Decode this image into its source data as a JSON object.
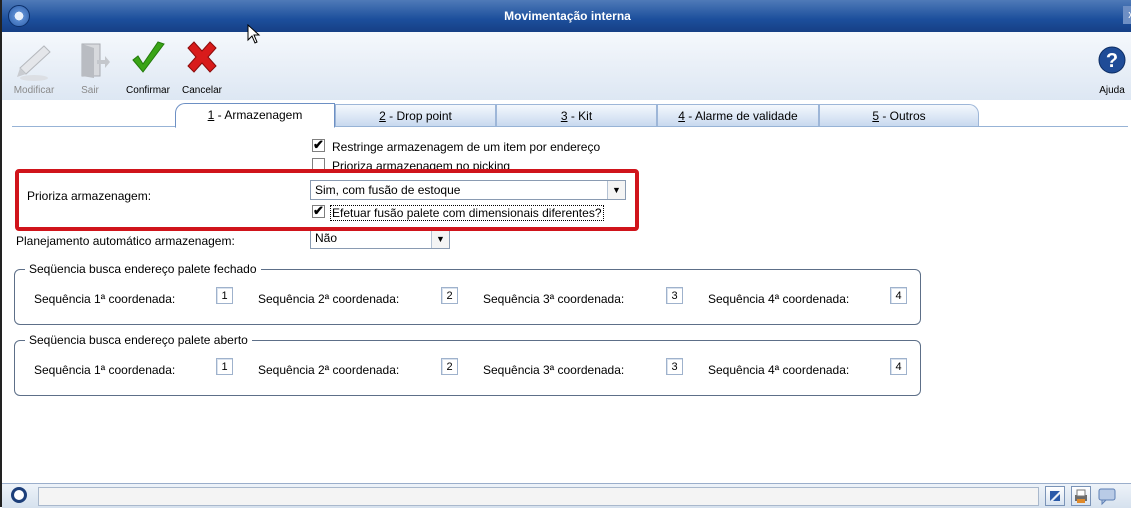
{
  "window": {
    "title": "Movimentação interna",
    "close_label": "x"
  },
  "toolbar": {
    "modificar": "Modificar",
    "sair": "Sair",
    "confirmar": "Confirmar",
    "cancelar": "Cancelar",
    "ajuda": "Ajuda"
  },
  "tabs": [
    {
      "key": "1",
      "label": " - Armazenagem",
      "active": true
    },
    {
      "key": "2",
      "label": " - Drop point"
    },
    {
      "key": "3",
      "label": " - Kit"
    },
    {
      "key": "4",
      "label": " - Alarme de validade"
    },
    {
      "key": "5",
      "label": " - Outros"
    }
  ],
  "form": {
    "restringe_label": "Restringe armazenagem de um item por endereço",
    "restringe_checked": true,
    "prioriza_picking_label": "Prioriza armazenagem no picking",
    "prioriza_picking_checked": false,
    "prioriza_label": "Prioriza armazenagem:",
    "prioriza_value": "Sim, com fusão de estoque",
    "fusao_label": "Efetuar fusão palete com dimensionais diferentes?",
    "fusao_checked": true,
    "planejamento_label": "Planejamento automático armazenagem:",
    "planejamento_value": "Não"
  },
  "groups": [
    {
      "title": "Seqüencia busca endereço palete fechado",
      "fields": [
        {
          "label": "Sequência 1ª coordenada:",
          "value": "1"
        },
        {
          "label": "Sequência 2ª coordenada:",
          "value": "2"
        },
        {
          "label": "Sequência 3ª coordenada:",
          "value": "3"
        },
        {
          "label": "Sequência 4ª coordenada:",
          "value": "4"
        }
      ]
    },
    {
      "title": "Seqüencia busca endereço palete aberto",
      "fields": [
        {
          "label": "Sequência 1ª coordenada:",
          "value": "1"
        },
        {
          "label": "Sequência 2ª coordenada:",
          "value": "2"
        },
        {
          "label": "Sequência 3ª coordenada:",
          "value": "3"
        },
        {
          "label": "Sequência 4ª coordenada:",
          "value": "4"
        }
      ]
    }
  ],
  "colors": {
    "titlebar": "#1c4f9c",
    "highlight": "#d0141b",
    "confirm": "#3aa416",
    "cancel": "#d81b1b"
  },
  "icons": [
    "app-icon",
    "close-icon",
    "pencil-icon",
    "exit-door-icon",
    "checkmark-icon",
    "x-cancel-icon",
    "help-icon",
    "status-circle-icon",
    "resize-icon",
    "print-icon",
    "chat-icon"
  ]
}
